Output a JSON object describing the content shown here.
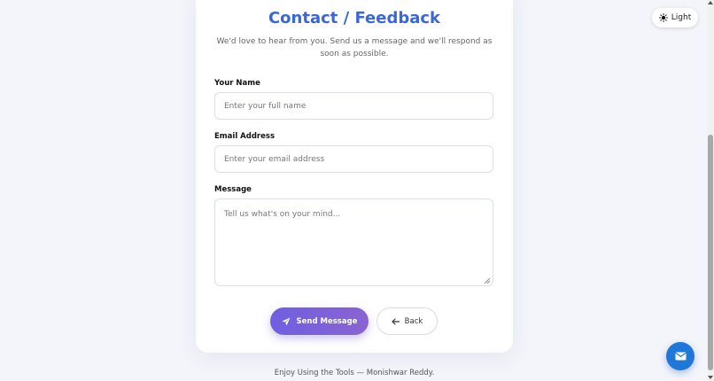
{
  "form": {
    "title": "Contact / Feedback",
    "subtitle": "We'd love to hear from you. Send us a message and we'll respond as soon as possible.",
    "name_label": "Your Name",
    "name_placeholder": "Enter your full name",
    "name_value": "",
    "email_label": "Email Address",
    "email_placeholder": "Enter your email address",
    "email_value": "",
    "message_label": "Message",
    "message_placeholder": "Tell us what's on your mind...",
    "message_value": "",
    "send_label": "Send Message",
    "send_icon": "paper-plane-icon",
    "back_label": "Back",
    "back_icon": "arrow-left-icon"
  },
  "theme_toggle": {
    "label": "Light",
    "icon": "sun-icon"
  },
  "footer": {
    "text": "Enjoy Using the Tools — Monishwar Reddy."
  },
  "fab": {
    "icon": "envelope-icon"
  },
  "colors": {
    "title": "#3a67d8",
    "button_gradient_start": "#6f5fe0",
    "button_gradient_end": "#8a63d2",
    "fab": "#1f78d8",
    "background": "#f4f5fb"
  }
}
